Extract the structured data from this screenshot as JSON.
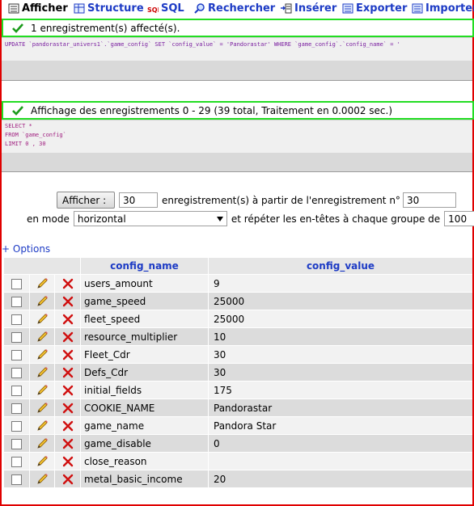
{
  "tabs": [
    {
      "label": "Afficher",
      "icon": "browse-icon",
      "active": true
    },
    {
      "label": "Structure",
      "icon": "structure-icon"
    },
    {
      "label": "SQL",
      "icon": "sql-icon"
    },
    {
      "label": "Rechercher",
      "icon": "search-icon"
    },
    {
      "label": "Insérer",
      "icon": "insert-icon"
    },
    {
      "label": "Exporter",
      "icon": "export-icon"
    },
    {
      "label": "Importer",
      "icon": "import-icon"
    }
  ],
  "notice1": "1 enregistrement(s) affecté(s).",
  "query1": "UPDATE `pandorastar_univers1`.`game_config` SET `config_value` = 'Pandorastar' WHERE `game_config`.`config_name` = '",
  "notice2": "Affichage des enregistrements 0 - 29 (39 total, Traitement en 0.0002 sec.)",
  "query2": [
    "SELECT *",
    "FROM `game_config`",
    "LIMIT 0 , 30"
  ],
  "nav": {
    "show_button": "Afficher :",
    "rows_value": "30",
    "rows_text": "enregistrement(s) à partir de l'enregistrement n°",
    "start_value": "30",
    "mode_label": "en mode",
    "mode_value": "horizontal",
    "repeat_text": "et répéter les en-têtes à chaque groupe de",
    "repeat_value": "100"
  },
  "options_link": "+ Options",
  "table": {
    "headers": [
      "config_name",
      "config_value"
    ],
    "rows": [
      {
        "name": "users_amount",
        "value": "9"
      },
      {
        "name": "game_speed",
        "value": "25000"
      },
      {
        "name": "fleet_speed",
        "value": "25000"
      },
      {
        "name": "resource_multiplier",
        "value": "10"
      },
      {
        "name": "Fleet_Cdr",
        "value": "30"
      },
      {
        "name": "Defs_Cdr",
        "value": "30"
      },
      {
        "name": "initial_fields",
        "value": "175"
      },
      {
        "name": "COOKIE_NAME",
        "value": "Pandorastar"
      },
      {
        "name": "game_name",
        "value": "Pandora Star"
      },
      {
        "name": "game_disable",
        "value": "0"
      },
      {
        "name": "close_reason",
        "value": ""
      },
      {
        "name": "metal_basic_income",
        "value": "20"
      }
    ]
  },
  "colors": {
    "link": "#1d3bc5",
    "success_border": "#22dd22",
    "frame": "#e00000"
  }
}
